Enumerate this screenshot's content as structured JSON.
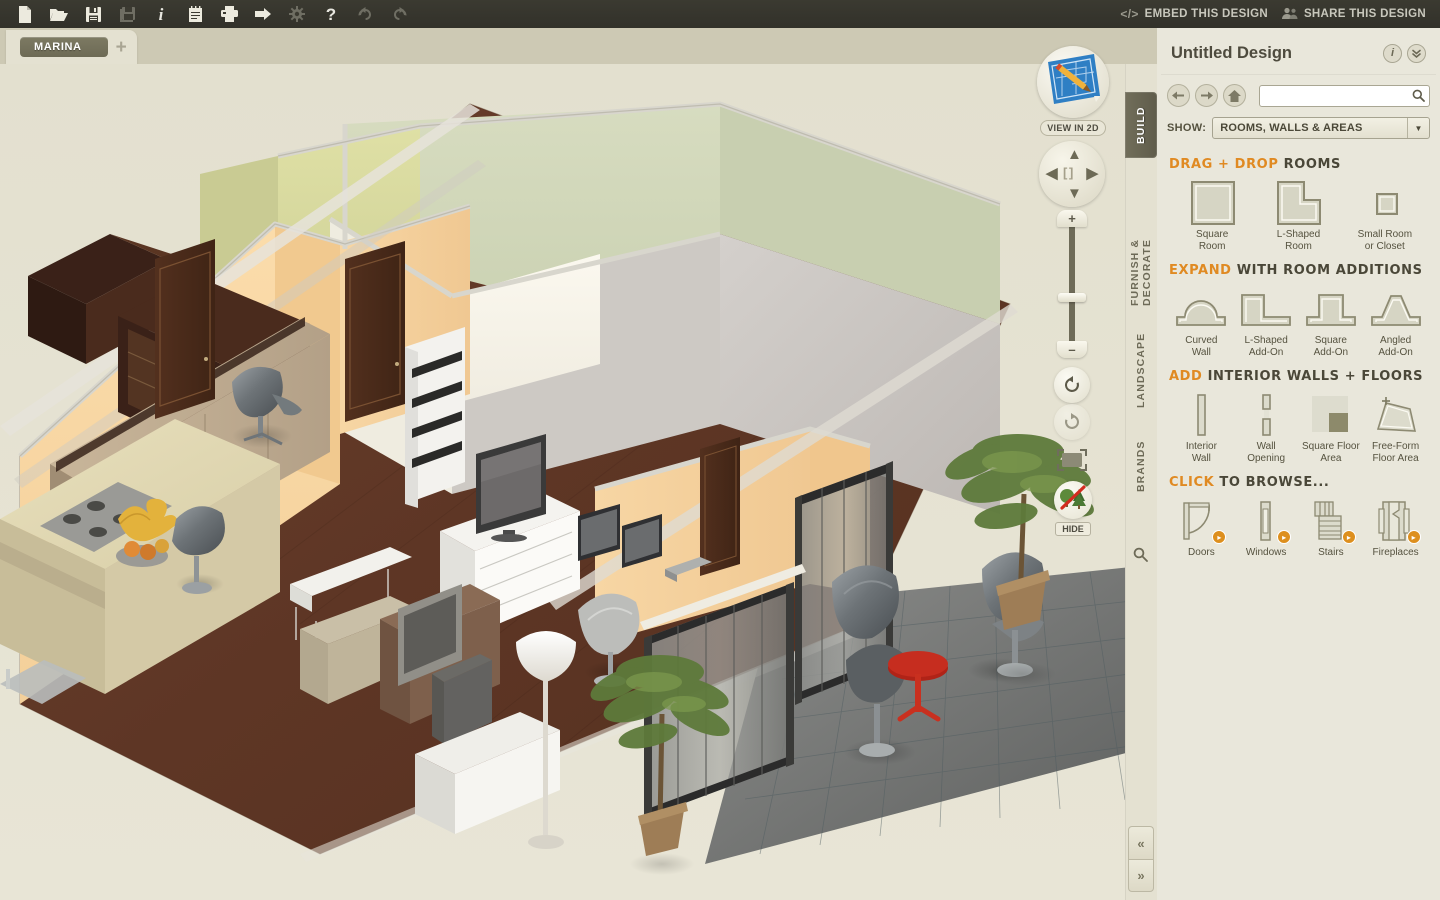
{
  "toolbar": {
    "icons": [
      {
        "name": "new-file-icon",
        "label": "New"
      },
      {
        "name": "open-folder-icon",
        "label": "Open"
      },
      {
        "name": "save-icon",
        "label": "Save"
      },
      {
        "name": "save-as-icon",
        "label": "Save As",
        "dim": true
      },
      {
        "name": "info-icon",
        "label": "Info"
      },
      {
        "name": "notes-icon",
        "label": "Notes"
      },
      {
        "name": "print-icon",
        "label": "Print"
      },
      {
        "name": "export-icon",
        "label": "Export"
      },
      {
        "name": "settings-gear-icon",
        "label": "Settings",
        "dim": true
      },
      {
        "name": "help-icon",
        "label": "Help"
      },
      {
        "name": "undo-icon",
        "label": "Undo",
        "dim": true
      },
      {
        "name": "redo-icon",
        "label": "Redo",
        "dim": true
      }
    ],
    "embed_label": "EMBED THIS DESIGN",
    "embed_icon": "</>",
    "share_label": "SHARE THIS DESIGN",
    "share_icon": "people-icon"
  },
  "tabs": {
    "documents": [
      {
        "label": "MARINA",
        "active": true
      }
    ],
    "add_label": "+"
  },
  "viewport": {
    "view_2d_label": "VIEW IN 2D",
    "view_2d_icon": "blueprint-pencil-icon",
    "dpad": {
      "up": "⌃",
      "down": "⌄",
      "left": "‹",
      "right": "›",
      "center": "[ ]"
    },
    "zoom_plus": "+",
    "zoom_minus": "–",
    "rotate_left_icon": "rotate-left-icon",
    "rotate_right_icon": "rotate-right-icon",
    "fit_icon": "fit-to-screen-icon",
    "hide_label": "HIDE",
    "hide_icon": "hide-trees-icon"
  },
  "rail": {
    "tabs": [
      {
        "label": "BUILD",
        "active": true
      },
      {
        "label": "FURNISH & DECORATE",
        "active": false
      },
      {
        "label": "LANDSCAPE",
        "active": false
      },
      {
        "label": "BRANDS",
        "active": false
      }
    ],
    "search_icon": "search-icon"
  },
  "panel": {
    "title": "Untitled Design",
    "info_label": "i",
    "collapse_label": "»",
    "nav": {
      "back": "←",
      "forward": "→",
      "home": "⌂"
    },
    "search": {
      "value": "",
      "placeholder": ""
    },
    "show_label": "SHOW:",
    "show_value": "ROOMS, WALLS & AREAS",
    "show_arrow": "▼",
    "sections": [
      {
        "name": "drag-drop-rooms",
        "title_highlight": "DRAG + DROP",
        "title_rest": " ROOMS",
        "items": [
          {
            "icon": "square-room-icon",
            "label": "Square\nRoom"
          },
          {
            "icon": "l-shaped-room-icon",
            "label": "L-Shaped\nRoom"
          },
          {
            "icon": "small-room-icon",
            "label": "Small Room\nor Closet"
          }
        ]
      },
      {
        "name": "room-additions",
        "title_highlight": "EXPAND",
        "title_rest": " WITH ROOM ADDITIONS",
        "items": [
          {
            "icon": "curved-wall-icon",
            "label": "Curved\nWall"
          },
          {
            "icon": "l-shaped-addon-icon",
            "label": "L-Shaped\nAdd-On"
          },
          {
            "icon": "square-addon-icon",
            "label": "Square\nAdd-On"
          },
          {
            "icon": "angled-addon-icon",
            "label": "Angled\nAdd-On"
          }
        ]
      },
      {
        "name": "interior-walls-floors",
        "title_highlight": "ADD",
        "title_rest": " INTERIOR WALLS + FLOORS",
        "items": [
          {
            "icon": "interior-wall-icon",
            "label": "Interior\nWall"
          },
          {
            "icon": "wall-opening-icon",
            "label": "Wall\nOpening"
          },
          {
            "icon": "square-floor-area-icon",
            "label": "Square Floor\nArea"
          },
          {
            "icon": "free-form-floor-area-icon",
            "label": "Free-Form\nFloor Area"
          }
        ]
      },
      {
        "name": "click-to-browse",
        "title_highlight": "CLICK",
        "title_rest": " TO BROWSE...",
        "items": [
          {
            "icon": "doors-icon",
            "label": "Doors",
            "badge": true
          },
          {
            "icon": "windows-icon",
            "label": "Windows",
            "badge": true
          },
          {
            "icon": "stairs-icon",
            "label": "Stairs",
            "badge": true
          },
          {
            "icon": "fireplaces-icon",
            "label": "Fireplaces",
            "badge": true
          }
        ]
      }
    ]
  },
  "collapse": {
    "up": "«",
    "down": "»"
  },
  "colors": {
    "accent_orange": "#e08a22",
    "toolbar_dark": "#3b3a31",
    "panel_bg": "#e9e7db",
    "canvas_bg": "#e5e2d2",
    "tab_olive": "#7d7a63"
  }
}
